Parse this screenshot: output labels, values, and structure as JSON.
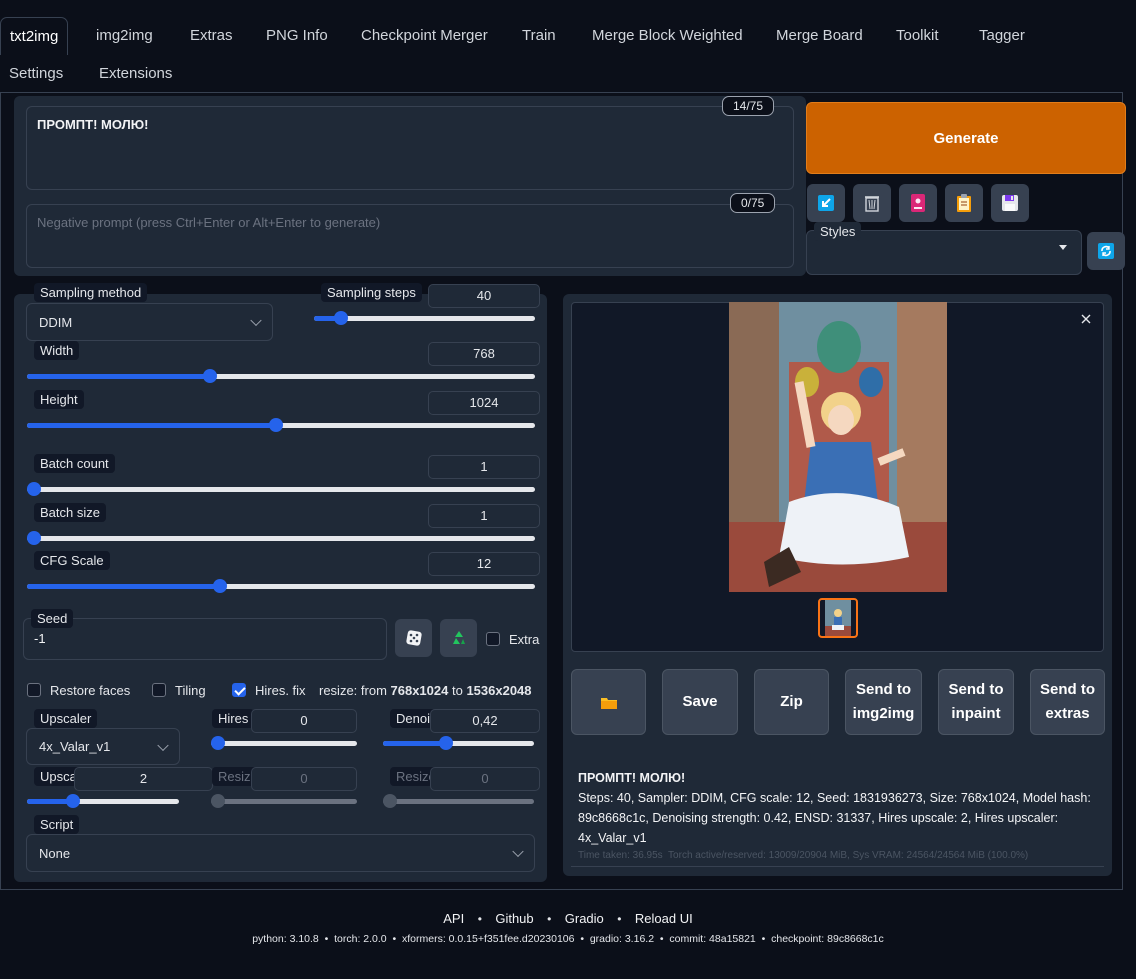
{
  "tabs_row1": [
    "txt2img",
    "img2img",
    "Extras",
    "PNG Info",
    "Checkpoint Merger",
    "Train",
    "Merge Block Weighted",
    "Merge Board",
    "Toolkit",
    "Tagger"
  ],
  "tabs_row2": [
    "Settings",
    "Extensions"
  ],
  "prompt": {
    "value": "ПРОМПТ! МОЛЮ!",
    "counter": "14/75",
    "negative_placeholder": "Negative prompt (press Ctrl+Enter or Alt+Enter to generate)",
    "negative_counter": "0/75"
  },
  "generate_label": "Generate",
  "styles_label": "Styles",
  "params": {
    "sampling_method_label": "Sampling method",
    "sampling_method_value": "DDIM",
    "sampling_steps_label": "Sampling steps",
    "sampling_steps_value": "40",
    "width_label": "Width",
    "width_value": "768",
    "height_label": "Height",
    "height_value": "1024",
    "batch_count_label": "Batch count",
    "batch_count_value": "1",
    "batch_size_label": "Batch size",
    "batch_size_value": "1",
    "cfg_label": "CFG Scale",
    "cfg_value": "12",
    "seed_label": "Seed",
    "seed_value": "-1",
    "extra_label": "Extra",
    "restore_faces_label": "Restore faces",
    "tiling_label": "Tiling",
    "hires_fix_label": "Hires. fix",
    "resize_prefix": "resize: from ",
    "resize_from": "768x1024",
    "resize_to_word": " to ",
    "resize_to": "1536x2048",
    "upscaler_label": "Upscaler",
    "upscaler_value": "4x_Valar_v1",
    "hires_steps_label": "Hires",
    "hires_steps_value": "0",
    "denoise_label": "Denoi",
    "denoise_value": "0,42",
    "upscale_by_label": "Upsca",
    "upscale_by_value": "2",
    "resize_w_label": "Resize",
    "resize_w_value": "0",
    "resize_h_label": "Resize",
    "resize_h_value": "0",
    "script_label": "Script",
    "script_value": "None"
  },
  "slider_fractions": {
    "sampling_steps": 0.12,
    "width": 0.36,
    "height": 0.49,
    "batch_count": 0.0,
    "batch_size": 0.0,
    "cfg": 0.38,
    "hires_steps": 0.0,
    "denoise": 0.42,
    "upscale_by": 0.3,
    "resize_w": 0.0,
    "resize_h": 0.0
  },
  "output_buttons": {
    "folder_icon": "folder-icon",
    "save": "Save",
    "zip": "Zip",
    "send_img2img": "Send to img2img",
    "send_inpaint": "Send to inpaint",
    "send_extras": "Send to extras"
  },
  "info": {
    "prompt": "ПРОМПТ! МОЛЮ!",
    "params": "Steps: 40, Sampler: DDIM, CFG scale: 12, Seed: 1831936273, Size: 768x1024, Model hash: 89c8668c1c, Denoising strength: 0.42, ENSD: 31337, Hires upscale: 2, Hires upscaler: 4x_Valar_v1",
    "time": "Time taken: 36.95s  Torch active/reserved: 13009/20904 MiB, Sys VRAM: 24564/24564 MiB (100.0%)"
  },
  "footer": {
    "links": [
      "API",
      "Github",
      "Gradio",
      "Reload UI"
    ],
    "versions": "python: 3.10.8  •  torch: 2.0.0  •  xformers: 0.0.15+f351fee.d20230106  •  gradio: 3.16.2  •  commit: 48a15821  •  checkpoint: 89c8668c1c"
  },
  "colors": {
    "accent": "#2563eb",
    "generate": "#cc6200",
    "background": "#0b0f19",
    "panel": "#1f2937"
  }
}
